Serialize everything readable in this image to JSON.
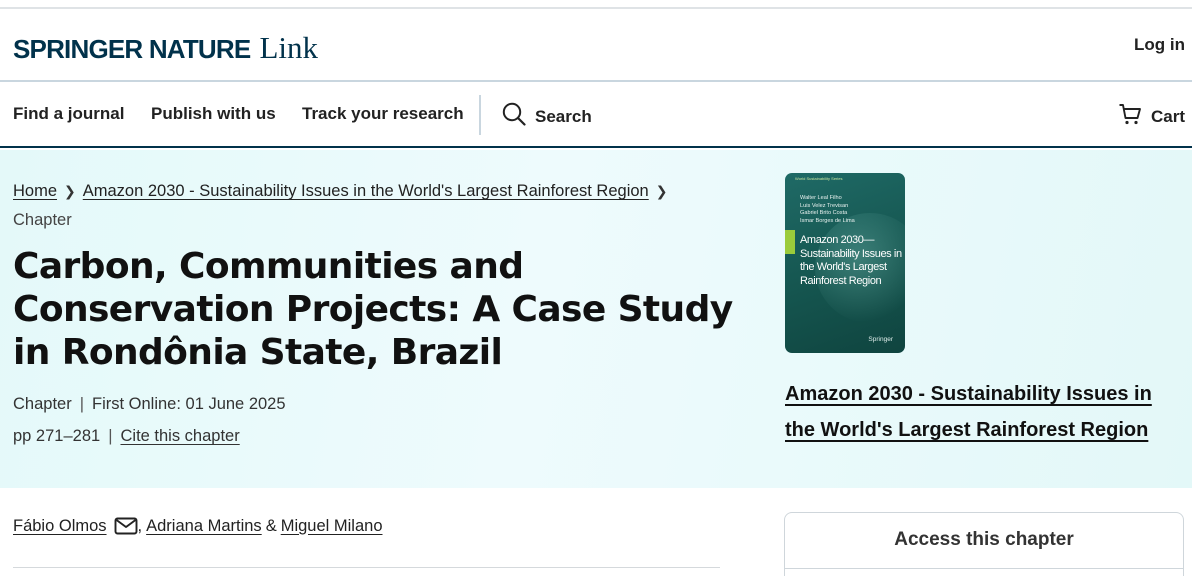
{
  "header": {
    "brand": "SPRINGER NATURE",
    "brand_link": "Link",
    "login": "Log in"
  },
  "nav": {
    "items": [
      "Find a journal",
      "Publish with us",
      "Track your research"
    ],
    "search": "Search",
    "cart": "Cart"
  },
  "breadcrumb": {
    "home": "Home",
    "book": "Amazon 2030 - Sustainability Issues in the World's Largest Rainforest Region",
    "current": "Chapter"
  },
  "chapter": {
    "title": "Carbon, Communities and Conservation Projects: A Case Study in Rondônia State, Brazil",
    "type": "Chapter",
    "first_online": "First Online: 01 June 2025",
    "pages": "pp 271–281",
    "cite": "Cite this chapter"
  },
  "book": {
    "cover_series": "World Sustainability Series",
    "cover_editors": [
      "Walter Leal Filho",
      "Luis Velez Trevisan",
      "Gabriel Brito Costa",
      "Ismar Borges de Lima",
      "Editors"
    ],
    "cover_title": "Amazon 2030—Sustainability Issues in the World's Largest Rainforest Region",
    "cover_publisher": "Springer",
    "title": "Amazon 2030 - Sustainability Issues in the World's Largest Rainforest Region"
  },
  "authors": {
    "a1": "Fábio Olmos",
    "sep1": ",",
    "a2": "Adriana Martins",
    "sep2": "&",
    "a3": "Miguel Milano"
  },
  "access": {
    "title": "Access this chapter"
  },
  "colors": {
    "brand": "#01324b",
    "hero_bg": "#e4f9f9",
    "cover_green": "#1f6a66",
    "cover_accent": "#9bcb3b"
  }
}
